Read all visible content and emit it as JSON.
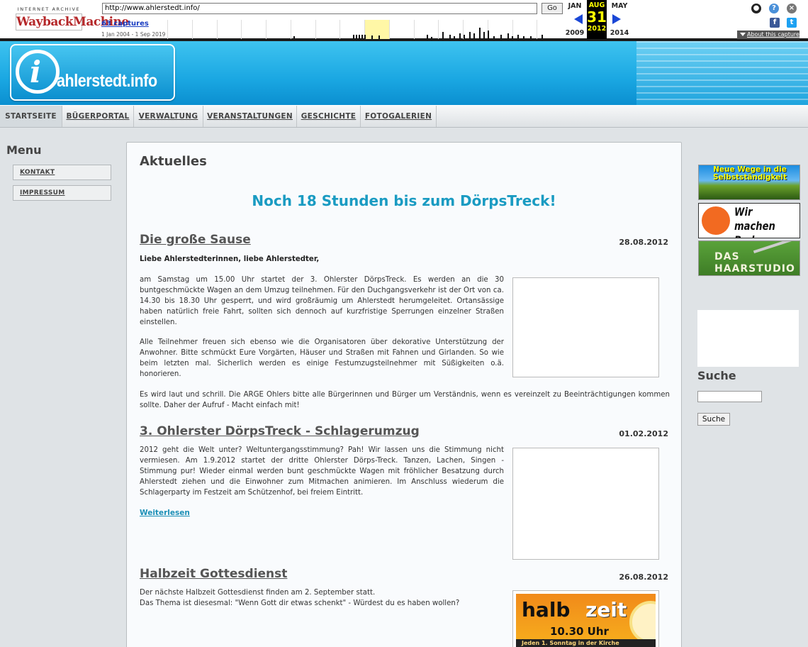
{
  "wayback": {
    "logo_line1": "INTERNET ARCHIVE",
    "logo_line2": "WaybackMachine",
    "url": "http://www.ahlerstedt.info/",
    "go_label": "Go",
    "captures": "63 captures",
    "date_range": "1 Jan 2004 - 1 Sep 2019",
    "prev_month": "JAN",
    "cur_month": "AUG",
    "next_month": "MAY",
    "cur_day": "31",
    "prev_year": "2009",
    "cur_year": "2012",
    "next_year": "2014",
    "about": "About this capture"
  },
  "site": {
    "logo_text": "ahlerstedt.info",
    "logo_letter": "i"
  },
  "nav": {
    "tabs": [
      "STARTSEITE",
      "BÜGERPORTAL",
      "VERWALTUNG",
      "VERANSTALTUNGEN",
      "GESCHICHTE",
      "FOTOGALERIEN"
    ]
  },
  "menu": {
    "title": "Menu",
    "items": [
      "KONTAKT",
      "IMPRESSUM"
    ]
  },
  "main": {
    "heading": "Aktuelles",
    "banner": "Noch 18 Stunden bis zum DörpsTreck!",
    "articles": [
      {
        "title": "Die große Sause",
        "date": "28.08.2012",
        "greeting": "Liebe Ahlerstedterinnen, liebe Ahlerstedter,",
        "p1": "am Samstag um 15.00 Uhr startet der 3. Ohlerster DörpsTreck. Es werden an die 30 buntgeschmückte Wagen an dem Umzug teilnehmen. Für den Duchgangsverkehr ist der Ort von ca. 14.30 bis 18.30 Uhr gesperrt, und wird großräumig um Ahlerstedt herumgeleitet. Ortansässige haben natürlich freie Fahrt, sollten sich dennoch auf kurzfristige Sperrungen einzelner Straßen einstellen.",
        "p2": "Alle Teilnehmer freuen sich ebenso wie die Organisatoren über dekorative Unterstützung der Anwohner. Bitte schmückt Eure Vorgärten, Häuser und Straßen mit Fahnen und Girlanden. So wie beim letzten mal. Sicherlich werden es einige Festumzugsteilnehmer mit Süßigkeiten o.ä. honorieren.",
        "p3": "Es wird laut und schrill. Die ARGE Ohlers bitte alle Bürgerinnen und Bürger um Verständnis, wenn es vereinzelt zu Beeinträchtigungen kommen sollte. Daher der Aufruf - Macht einfach mit!"
      },
      {
        "title": "3. Ohlerster DörpsTreck - Schlagerumzug",
        "date": "01.02.2012",
        "p1": "2012 geht die Welt unter? Weltuntergangsstimmung? Pah! Wir lassen uns die Stimmung nicht vermiesen. Am 1.9.2012 startet der dritte Ohlerster Dörps-Treck. Tanzen, Lachen, Singen - Stimmung pur! Wieder einmal werden bunt geschmückte Wagen mit fröhlicher Besatzung durch Ahlerstedt ziehen und die Einwohner zum Mitmachen animieren. Im Anschluss wiederum die Schlagerparty im Festzeit am Schützenhof, bei freiem Eintritt.",
        "readmore": "Weiterlesen"
      },
      {
        "title": "Halbzeit Gottesdienst",
        "date": "26.08.2012",
        "p1": "Der nächste Halbzeit Gottesdienst finden am 2. September statt.",
        "p2": "Das Thema ist diesesmal: \"Wenn Gott dir etwas schenkt\" - Würdest du es haben wollen?",
        "img": {
          "word1": "halb",
          "word2": "zeit",
          "time": "10.30 Uhr",
          "sub": "Jeden 1. Sonntag in der Kirche"
        }
      }
    ]
  },
  "sidebar": {
    "ad1": "Neue Wege in die Selbstständigkeit",
    "ad2": "Wir machen Boden gut!",
    "ad3": "DAS HAARSTUDIO",
    "search_title": "Suche",
    "search_button": "Suche"
  }
}
